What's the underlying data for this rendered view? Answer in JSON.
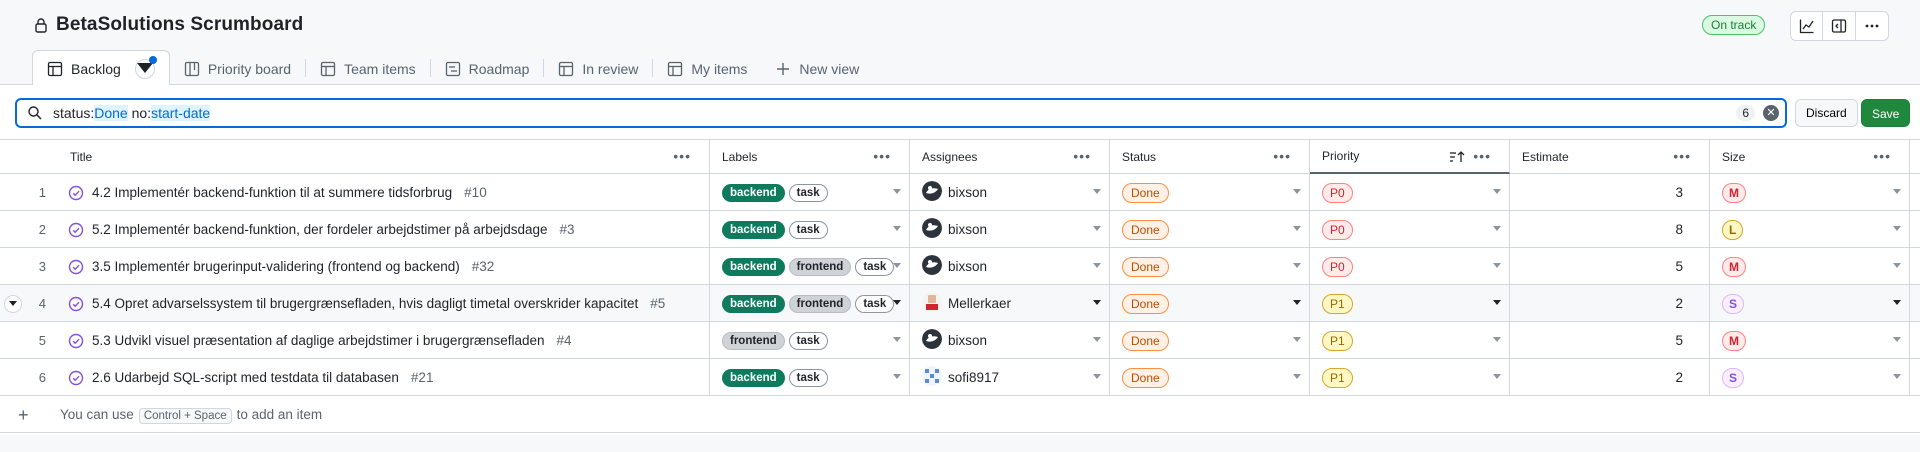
{
  "project": {
    "title": "BetaSolutions Scrumboard",
    "status": "On track"
  },
  "tabs": [
    {
      "label": "Backlog",
      "icon": "table-icon"
    },
    {
      "label": "Priority board",
      "icon": "board-icon"
    },
    {
      "label": "Team items",
      "icon": "table-icon"
    },
    {
      "label": "Roadmap",
      "icon": "roadmap-icon"
    },
    {
      "label": "In review",
      "icon": "table-icon"
    },
    {
      "label": "My items",
      "icon": "table-icon"
    },
    {
      "label": "New view",
      "icon": "plus-icon"
    }
  ],
  "filter": {
    "key1": "status:",
    "val1": "Done",
    "space": " ",
    "key2": "no:",
    "val2": "start-date",
    "count": "6",
    "discard": "Discard",
    "save": "Save"
  },
  "columns": {
    "title": "Title",
    "labels": "Labels",
    "assignees": "Assignees",
    "status": "Status",
    "priority": "Priority",
    "estimate": "Estimate",
    "size": "Size"
  },
  "rows": [
    {
      "n": "1",
      "title": "4.2 Implementér backend-funktion til at summere tidsforbrug",
      "ref": "#10",
      "labels": [
        "backend",
        "task"
      ],
      "assignee": "bixson",
      "status": "Done",
      "priority": "P0",
      "estimate": "3",
      "size": "M"
    },
    {
      "n": "2",
      "title": "5.2 Implementér backend-funktion, der fordeler arbejdstimer på arbejdsdage",
      "ref": "#3",
      "labels": [
        "backend",
        "task"
      ],
      "assignee": "bixson",
      "status": "Done",
      "priority": "P0",
      "estimate": "8",
      "size": "L"
    },
    {
      "n": "3",
      "title": "3.5 Implementér brugerinput-validering (frontend og backend)",
      "ref": "#32",
      "labels": [
        "backend",
        "frontend",
        "task"
      ],
      "assignee": "bixson",
      "status": "Done",
      "priority": "P0",
      "estimate": "5",
      "size": "M"
    },
    {
      "n": "4",
      "title": "5.4 Opret advarselssystem til brugergrænsefladen, hvis dagligt timetal overskrider kapacitet",
      "ref": "#5",
      "labels": [
        "backend",
        "frontend",
        "task"
      ],
      "assignee": "Mellerkaer",
      "status": "Done",
      "priority": "P1",
      "estimate": "2",
      "size": "S"
    },
    {
      "n": "5",
      "title": "5.3 Udvikl visuel præsentation af daglige arbejdstimer i brugergrænsefladen",
      "ref": "#4",
      "labels": [
        "frontend",
        "task"
      ],
      "assignee": "bixson",
      "status": "Done",
      "priority": "P1",
      "estimate": "5",
      "size": "M"
    },
    {
      "n": "6",
      "title": "2.6 Udarbejd SQL-script med testdata til databasen",
      "ref": "#21",
      "labels": [
        "backend",
        "task"
      ],
      "assignee": "sofi8917",
      "status": "Done",
      "priority": "P1",
      "estimate": "2",
      "size": "S"
    }
  ],
  "add_item": {
    "pre": "You can use",
    "kbd": "Control + Space",
    "post": "to add an item"
  },
  "colors": {
    "accent": "#0969da",
    "save": "#1f883d",
    "backend": "#0e7a5e"
  }
}
